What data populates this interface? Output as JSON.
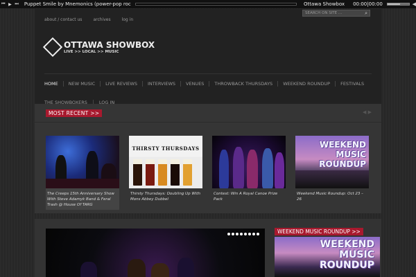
{
  "player": {
    "controls": [
      "⏮",
      "▶",
      "⏭"
    ],
    "track": "Puppet Smile by Mnemonics (power-pop rock n roll)",
    "progress": 0.0,
    "site": "Ottawa Showbox",
    "time": "00:00|00:00",
    "volume": 0.6,
    "volume_icon": "speaker-icon"
  },
  "header": {
    "top_links": [
      "about / contact us",
      "archives",
      "log in"
    ],
    "search_placeholder": "SEARCH ON SITE ...",
    "logo_mark": "OSBX",
    "logo_name": "OTTAWA SHOWBOX",
    "logo_tag": "LIVE >> LOCAL >> MUSIC",
    "nav_row1": [
      "HOME",
      "NEW MUSIC",
      "LIVE REVIEWS",
      "INTERVIEWS",
      "VENUES",
      "THROWBACK THURSDAYS",
      "WEEKEND ROUNDUP",
      "FESTIVALS"
    ],
    "nav_row2": [
      "THE SHOWBOXERS",
      "LOG IN"
    ]
  },
  "most_recent": {
    "title": "MOST RECENT >>",
    "arrows": "◀ ▶",
    "cards": [
      {
        "caption": "The Creeps 15th Anniversary Show With Steve Adamyk Band & Feral Trash @ House Of TARG"
      },
      {
        "caption": "Thirsty Thursdays: Doubling Up With Mons Abbey Dubbel",
        "label": "THIRSTY THURSDAYS"
      },
      {
        "caption": "Contest: Win A Royal Canoe Prize Pack"
      },
      {
        "caption": "Weekend Music Roundup: Oct 23 – 26",
        "art_text": [
          "WEEKEND",
          "MUSIC",
          "ROUNDUP"
        ]
      }
    ]
  },
  "bottom": {
    "slider_dots": 8,
    "slider_active_dot": 1,
    "side_title": "WEEKEND MUSIC ROUNDUP >>",
    "side_art_text": [
      "WEEKEND",
      "MUSIC",
      "ROUNDUP"
    ]
  },
  "colors": {
    "accent": "#a8192e",
    "bg": "#2a2a2a",
    "panel": "#222222"
  }
}
